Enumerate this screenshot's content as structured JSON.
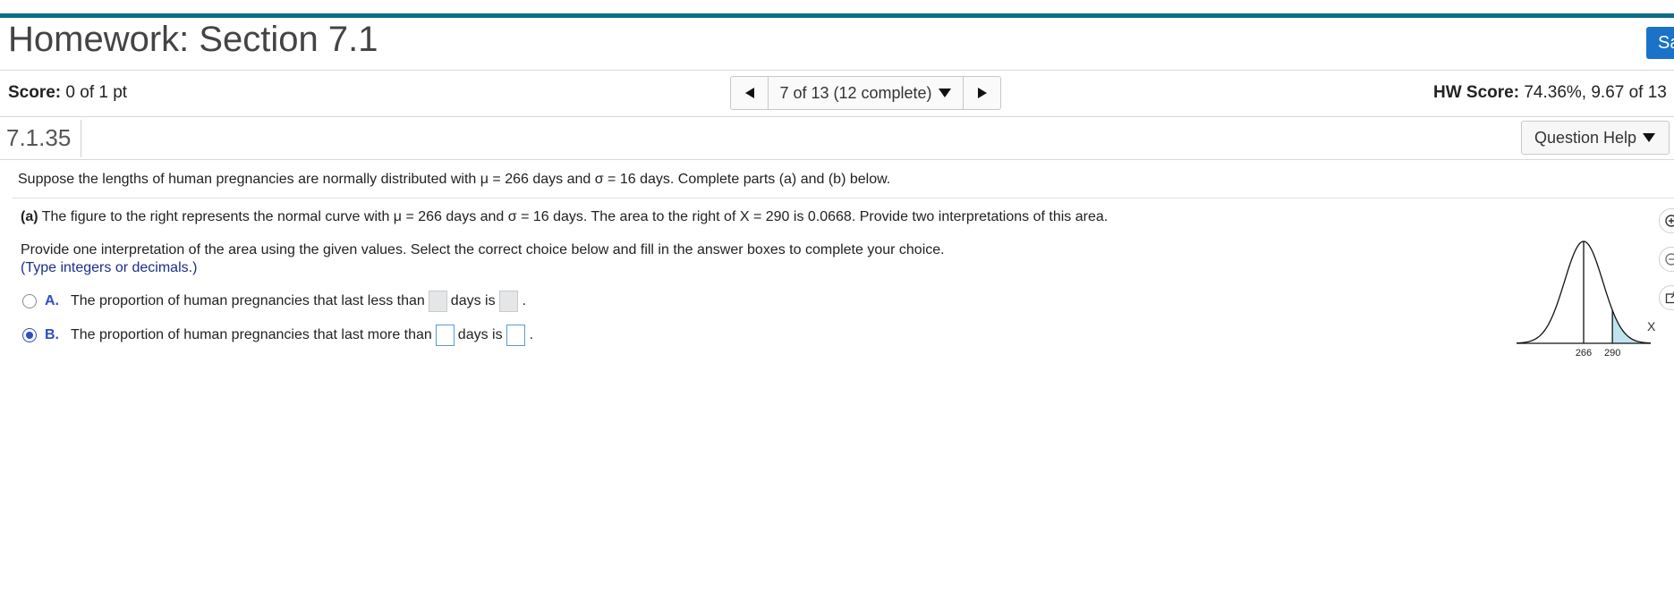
{
  "header": {
    "title": "Homework: Section 7.1",
    "save_label": "Sa"
  },
  "status": {
    "score_label": "Score:",
    "score_value": " 0 of 1 pt",
    "nav_label": "7 of 13 (12 complete)",
    "hw_score_label": "HW Score:",
    "hw_score_value": " 74.36%, 9.67 of 13"
  },
  "question": {
    "number": "7.1.35",
    "help_label": "Question Help",
    "intro": "Suppose the lengths of human pregnancies are normally distributed with μ = 266 days and σ = 16 days. Complete parts (a) and (b) below.",
    "part_a_label": "(a)",
    "part_a_text": " The figure to the right represents the normal curve with μ = 266 days and σ = 16 days. The area to the right of X = 290 is 0.0668. Provide two interpretations of this area.",
    "instruction": "Provide one interpretation of the area using the given values. Select the correct choice below and fill in the answer boxes to complete your choice.",
    "hint": "(Type integers or decimals.)",
    "choices": [
      {
        "letter": "A.",
        "text_before": "The proportion of human pregnancies that last less than",
        "text_middle": "days is",
        "text_end": ".",
        "selected": false
      },
      {
        "letter": "B.",
        "text_before": "The proportion of human pregnancies that last more than",
        "text_middle": "days is",
        "text_end": ".",
        "selected": true
      }
    ]
  },
  "figure": {
    "mean_label": "266",
    "x_label": "290",
    "axis_label": "X",
    "mean": 266,
    "sd": 16,
    "cutoff": 290,
    "shade_color": "#bfe3ef"
  },
  "colors": {
    "accent_bar": "#0f6d87",
    "save_button": "#1a73c8",
    "choice_letter": "#2b4fc7",
    "hint_text": "#1a2f8a"
  },
  "icons": {
    "nav_prev": "triangle-left-icon",
    "nav_next": "triangle-right-icon",
    "dropdown": "caret-down-icon",
    "zoom_in": "zoom-in-icon",
    "zoom_out": "zoom-out-icon",
    "popout": "popout-icon"
  }
}
